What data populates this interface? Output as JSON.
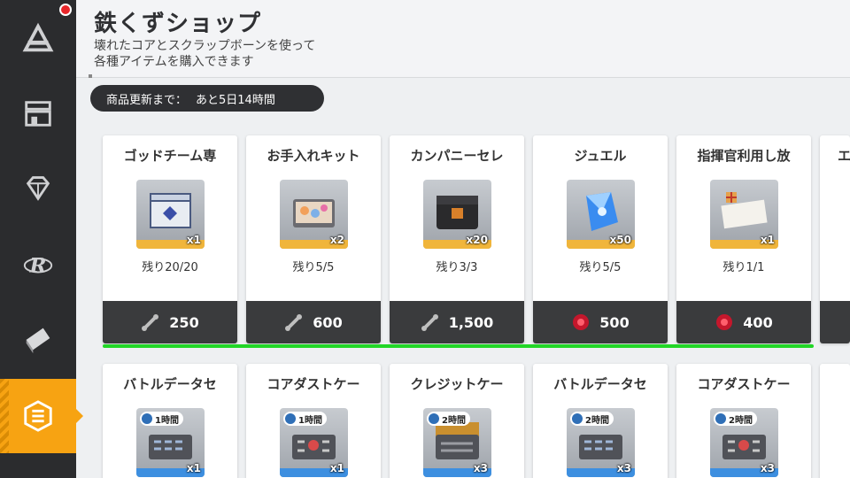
{
  "sidebar": {
    "items": [
      {
        "icon": "prism-icon"
      },
      {
        "icon": "shop-stall-icon"
      },
      {
        "icon": "diamond-icon"
      },
      {
        "icon": "r-emblem-icon"
      },
      {
        "icon": "ticket-icon"
      },
      {
        "icon": "scrap-bolt-icon",
        "active": true
      }
    ]
  },
  "header": {
    "title": "鉄くずショップ",
    "subtitle_line1": "壊れたコアとスクラップボーンを使って",
    "subtitle_line2": "各種アイテムを購入できます",
    "refresh_label": "商品更新まで：",
    "refresh_time": "あと5日14時間"
  },
  "row1": [
    {
      "name": "ゴッドチーム専",
      "qty": "x1",
      "remaining": "残り20/20",
      "currency": "scrap-bone-icon",
      "price": "250"
    },
    {
      "name": "お手入れキット",
      "qty": "x2",
      "remaining": "残り5/5",
      "currency": "scrap-bone-icon",
      "price": "600"
    },
    {
      "name": "カンパニーセレ",
      "qty": "x20",
      "remaining": "残り3/3",
      "currency": "scrap-bone-icon",
      "price": "1,500"
    },
    {
      "name": "ジュエル",
      "qty": "x50",
      "remaining": "残り5/5",
      "currency": "broken-core-icon",
      "price": "500"
    },
    {
      "name": "指揮官利用し放",
      "qty": "x1",
      "remaining": "残り1/1",
      "currency": "broken-core-icon",
      "price": "400"
    },
    {
      "name": "エ"
    }
  ],
  "row2": [
    {
      "name": "バトルデータセ",
      "time": "1時間",
      "qty": "x1"
    },
    {
      "name": "コアダストケー",
      "time": "1時間",
      "qty": "x1"
    },
    {
      "name": "クレジットケー",
      "time": "2時間",
      "qty": "x3"
    },
    {
      "name": "バトルデータセ",
      "time": "2時間",
      "qty": "x3"
    },
    {
      "name": "コアダストケー",
      "time": "2時間",
      "qty": "x3"
    }
  ],
  "colors": {
    "accent": "#f7a312",
    "highlight": "#21d626",
    "dark": "#2f3033"
  }
}
